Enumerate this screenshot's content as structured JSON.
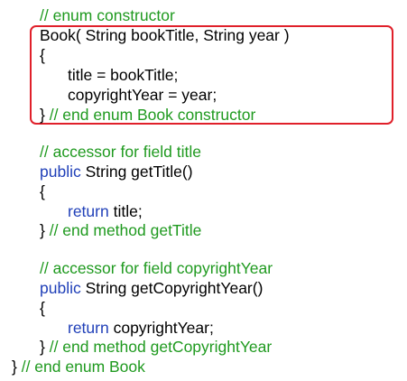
{
  "code": {
    "lines": [
      [
        {
          "t": "// enum constructor",
          "k": "comment"
        }
      ],
      [
        {
          "t": "Book( String bookTitle, String year )",
          "k": "code"
        }
      ],
      [
        {
          "t": "{",
          "k": "code"
        }
      ],
      [
        {
          "t": "title = bookTitle;",
          "k": "code"
        }
      ],
      [
        {
          "t": "copyrightYear = year;",
          "k": "code"
        }
      ],
      [
        {
          "t": "} ",
          "k": "code"
        },
        {
          "t": "// end enum Book constructor",
          "k": "comment"
        }
      ],
      [],
      [
        {
          "t": "// accessor for field title",
          "k": "comment"
        }
      ],
      [
        {
          "t": "public",
          "k": "keyword"
        },
        {
          "t": " String getTitle()",
          "k": "code"
        }
      ],
      [
        {
          "t": "{",
          "k": "code"
        }
      ],
      [
        {
          "t": "return",
          "k": "keyword"
        },
        {
          "t": " title;",
          "k": "code"
        }
      ],
      [
        {
          "t": "} ",
          "k": "code"
        },
        {
          "t": "// end method getTitle",
          "k": "comment"
        }
      ],
      [],
      [
        {
          "t": "// accessor for field copyrightYear",
          "k": "comment"
        }
      ],
      [
        {
          "t": "public",
          "k": "keyword"
        },
        {
          "t": " String getCopyrightYear()",
          "k": "code"
        }
      ],
      [
        {
          "t": "{",
          "k": "code"
        }
      ],
      [
        {
          "t": "return",
          "k": "keyword"
        },
        {
          "t": " copyrightYear;",
          "k": "code"
        }
      ],
      [
        {
          "t": "} ",
          "k": "code"
        },
        {
          "t": "// end method getCopyrightYear",
          "k": "comment"
        }
      ],
      [
        {
          "t": "} ",
          "k": "code"
        },
        {
          "t": "// end enum Book",
          "k": "comment"
        }
      ]
    ]
  },
  "colors": {
    "comment": "#1f9a1f",
    "keyword": "#1f3fb8",
    "code": "#000000",
    "highlight_border": "#e0202a"
  }
}
